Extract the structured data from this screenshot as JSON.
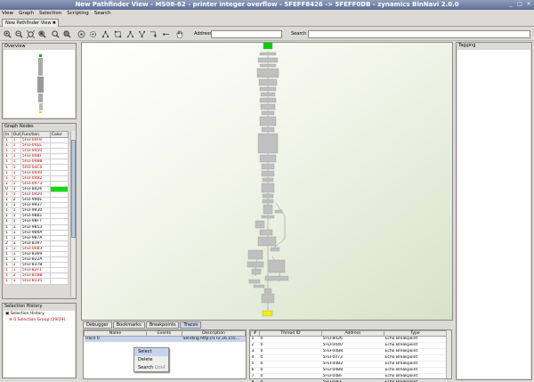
{
  "window": {
    "title": "New Pathfinder View - MS08-62 - printer integer overflow - 5FEFF8426 -> 5FEFF0DB - zynamics BinNavi 2.0.0"
  },
  "menu": [
    "View",
    "Graph",
    "Selection",
    "Scripting",
    "Search"
  ],
  "tab": {
    "label": "New Pathfinder View"
  },
  "toolbar": {
    "address_label": "Address",
    "search_label": "Search",
    "address_value": "",
    "search_value": ""
  },
  "overview": {
    "title": "Overview"
  },
  "graph_nodes": {
    "title": "Graph Nodes",
    "columns": [
      "In",
      "Out",
      "Function",
      "Color"
    ],
    "rows": [
      [
        "1",
        "1",
        "5FEF04F8",
        ""
      ],
      [
        "1",
        "1",
        "5FEF04EE",
        ""
      ],
      [
        "1",
        "1",
        "5FEF0450",
        ""
      ],
      [
        "1",
        "1",
        "5FEF04BF",
        ""
      ],
      [
        "1",
        "1",
        "5FEF04B8",
        ""
      ],
      [
        "1",
        "1",
        "5FEF04C0",
        ""
      ],
      [
        "1",
        "1",
        "5FEF0440",
        ""
      ],
      [
        "1",
        "1",
        "5FEF04B2",
        ""
      ],
      [
        "1",
        "1",
        "5FEF0473",
        ""
      ],
      [
        "0",
        "1",
        "5FEF8426",
        "green"
      ],
      [
        "1",
        "1",
        "5FEF0420",
        ""
      ],
      [
        "1",
        "2",
        "5FEF990E",
        ""
      ],
      [
        "1",
        "1",
        "5FEF9937",
        ""
      ],
      [
        "1",
        "1",
        "5FEF9930",
        ""
      ],
      [
        "1",
        "1",
        "5FEF98B1",
        ""
      ],
      [
        "1",
        "1",
        "5FEF98F7",
        ""
      ],
      [
        "1",
        "1",
        "5FEF9853",
        ""
      ],
      [
        "1",
        "1",
        "5FEF989A",
        ""
      ],
      [
        "1",
        "1",
        "5FEF987A",
        ""
      ],
      [
        "2",
        "1",
        "5FEF8397",
        ""
      ],
      [
        "1",
        "1",
        "5FEF0083",
        ""
      ],
      [
        "1",
        "1",
        "5FEF8369",
        ""
      ],
      [
        "1",
        "1",
        "5FEF822A",
        ""
      ],
      [
        "1",
        "1",
        "5FEF837B",
        ""
      ],
      [
        "1",
        "1",
        "5FEF82F1",
        ""
      ],
      [
        "1",
        "2",
        "5FEF81BB",
        ""
      ],
      [
        "1",
        "1",
        "5FEF8135",
        ""
      ]
    ],
    "red_rows": [
      0,
      1,
      2,
      3,
      4,
      5,
      6,
      7,
      8,
      10,
      20,
      24,
      25,
      26
    ],
    "green_color": "#00e000"
  },
  "selection_history": {
    "title": "Selection History",
    "root": "Selection History",
    "child": "0 Selection Group (29/29)"
  },
  "bottom_tabs": [
    "Debugger",
    "Bookmarks",
    "Breakpoints",
    "Traces"
  ],
  "traces": {
    "columns": [
      "Name",
      "Events",
      "Description"
    ],
    "rows": [
      [
        "Trace 0",
        "",
        "Sending http://172.16.155..."
      ]
    ]
  },
  "context_menu": [
    {
      "label": "Select",
      "shortcut": ""
    },
    {
      "label": "Delete",
      "shortcut": ""
    },
    {
      "label": "Search",
      "shortcut": "Ctrl-F"
    }
  ],
  "events_table": {
    "columns": [
      "#",
      "Thread ID",
      "Address",
      "Type"
    ],
    "rows": [
      [
        "1",
        "0",
        "5FEF8426",
        "Echo Breakpoint"
      ],
      [
        "2",
        "0",
        "5FEF0440",
        "Echo Breakpoint"
      ],
      [
        "3",
        "0",
        "5FEF04B8",
        "Echo Breakpoint"
      ],
      [
        "4",
        "0",
        "5FEF0473",
        "Echo Breakpoint"
      ],
      [
        "5",
        "0",
        "5FEF04B2",
        "Echo Breakpoint"
      ],
      [
        "6",
        "0",
        "5FEF04B8",
        "Echo Breakpoint"
      ],
      [
        "7",
        "0",
        "5FEF04BF",
        "Echo Breakpoint"
      ],
      [
        "8",
        "0",
        "5FEF04EE",
        "Echo Breakpoint"
      ]
    ]
  },
  "tagging": {
    "title": "Tagging"
  },
  "colors": {
    "start_node": "#00d000",
    "end_node": "#f0f000",
    "node_fill": "#c0c0c0"
  }
}
